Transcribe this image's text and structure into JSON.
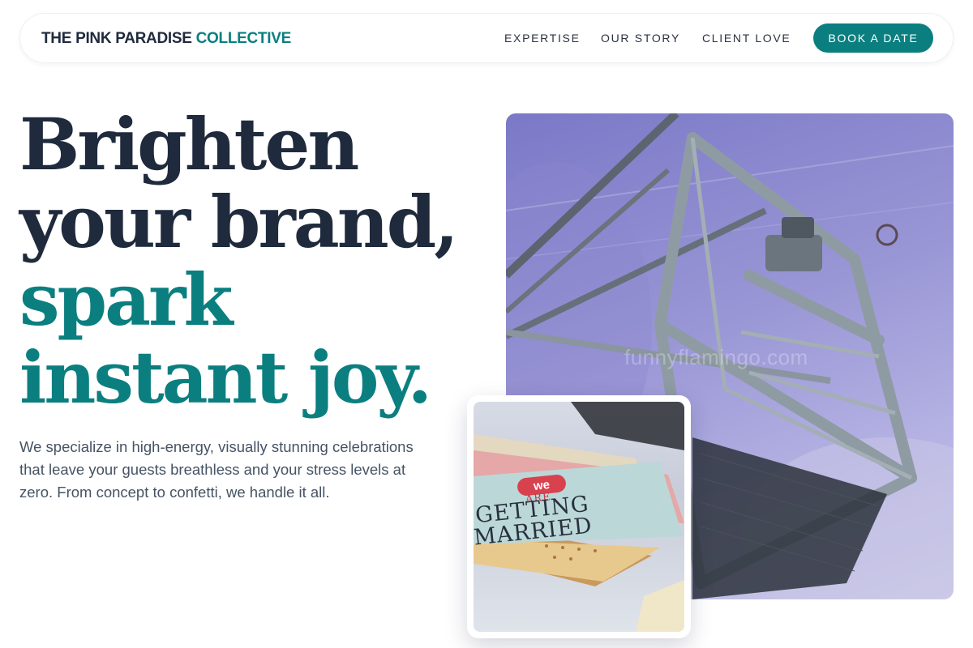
{
  "brand": {
    "name_primary": "THE PINK PARADISE",
    "name_accent": "COLLECTIVE"
  },
  "nav": {
    "links": [
      "EXPERTISE",
      "OUR STORY",
      "CLIENT LOVE"
    ],
    "cta": "BOOK A DATE"
  },
  "hero": {
    "headline_line1": "Brighten",
    "headline_line2": "your brand,",
    "headline_line3": "spark",
    "headline_line4": "instant joy.",
    "subcopy": "We specialize in high-energy, visually stunning celebrations that leave your guests breathless and your stress levels at zero. From concept to confetti, we handle it all."
  },
  "images": {
    "main_photo_watermark": "funnyflamingo.com",
    "card_photo_badge": "we",
    "card_photo_line1": "ARE",
    "card_photo_line2": "GETTING",
    "card_photo_line3": "MARRIED"
  },
  "colors": {
    "accent": "#0b7f80",
    "heading": "#1f2a3d",
    "body_text": "#465364"
  }
}
